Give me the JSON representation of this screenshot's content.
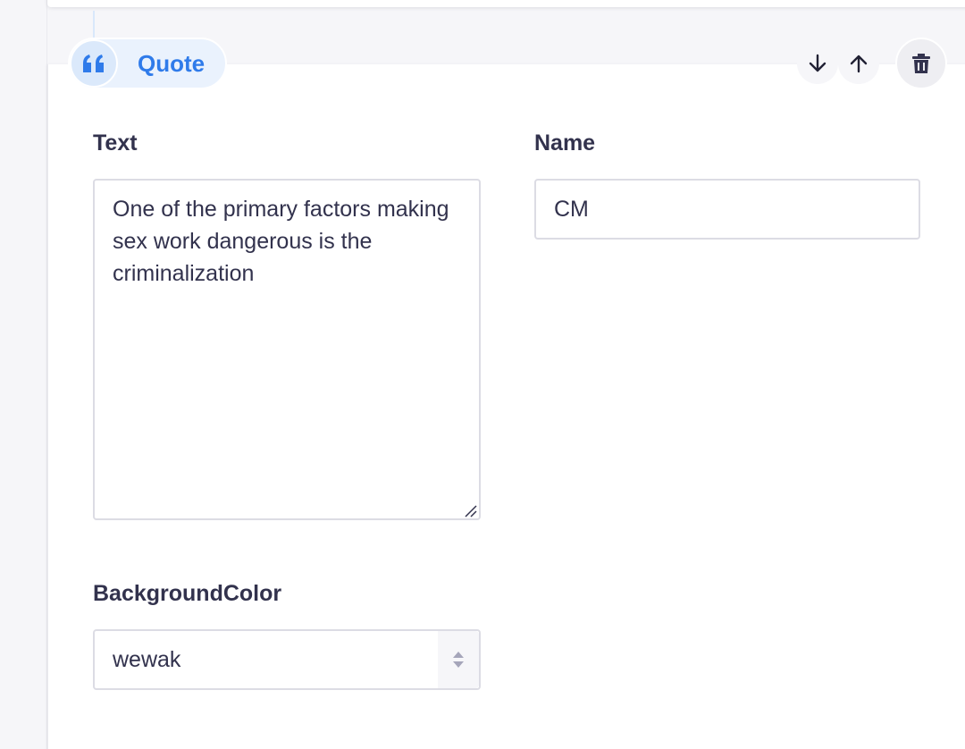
{
  "block": {
    "type_label": "Quote",
    "icon": "quote-icon",
    "accent_color": "#2f7bea"
  },
  "actions": {
    "move_down_icon": "arrow-down-icon",
    "move_up_icon": "arrow-up-icon",
    "delete_icon": "trash-icon"
  },
  "fields": {
    "text": {
      "label": "Text",
      "value": "One of the primary factors making sex work dangerous is the criminalization"
    },
    "name": {
      "label": "Name",
      "value": "CM"
    },
    "background_color": {
      "label": "BackgroundColor",
      "value": "wewak"
    }
  }
}
